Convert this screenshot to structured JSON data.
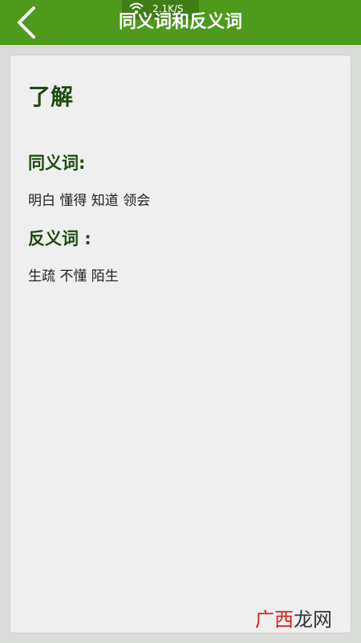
{
  "status_bar": {
    "network_speed": "2.1K/S"
  },
  "app_bar": {
    "title": "同义词和反义词",
    "back_icon": "chevron-left-icon"
  },
  "content": {
    "word": "了解",
    "synonyms": {
      "heading": "同义词:",
      "items": "明白 懂得 知道 领会"
    },
    "antonyms": {
      "heading": "反义词 :",
      "items": "生疏 不懂 陌生"
    }
  },
  "watermark": {
    "part1": "广西",
    "part2": "龙网"
  },
  "colors": {
    "app_bar": "#4e9a1c",
    "heading_green": "#1f4b10",
    "card_bg": "#efefef",
    "watermark_red": "#d51f1f"
  }
}
